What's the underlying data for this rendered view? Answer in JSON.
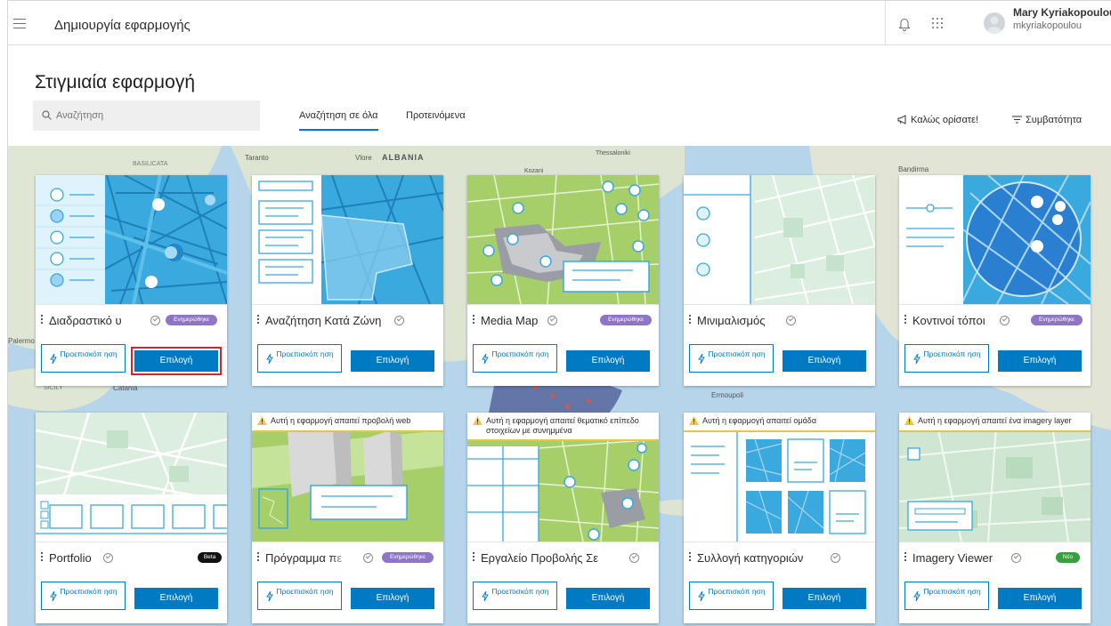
{
  "header": {
    "app_title": "Δημιουργία εφαρμογής",
    "user_name": "Mary Kyriakopoulou",
    "user_id": "mkyriakopoulou"
  },
  "page": {
    "title": "Στιγμιαία εφαρμογή",
    "search_placeholder": "Αναζήτηση",
    "tabs": [
      {
        "label": "Αναζήτηση σε όλα",
        "active": true
      },
      {
        "label": "Προτεινόμενα",
        "active": false
      }
    ],
    "welcome_label": "Καλώς ορίσατε!",
    "compat_label": "Συμβατότητα"
  },
  "map_labels": [
    {
      "text": "Taranto"
    },
    {
      "text": "Vlore"
    },
    {
      "text": "ALBANIA"
    },
    {
      "text": "BASILICATA"
    },
    {
      "text": "Thessaloniki"
    },
    {
      "text": "Kozani"
    },
    {
      "text": "Bandirma"
    },
    {
      "text": "Palermo"
    },
    {
      "text": "SICILY"
    },
    {
      "text": "Catania"
    },
    {
      "text": "Ermoupoli"
    }
  ],
  "cards": [
    {
      "title": "Διαδραστικό υ",
      "badge": "Ενημερώθηκε",
      "warning": "",
      "preview": "Προεπισκόπ ηση",
      "select": "Επιλογή"
    },
    {
      "title": "Αναζήτηση Κατά Ζώνη",
      "badge": "",
      "warning": "",
      "preview": "Προεπισκόπ ηση",
      "select": "Επιλογή"
    },
    {
      "title": "Media Map",
      "badge": "Ενημερώθηκε",
      "warning": "",
      "preview": "Προεπισκόπ ηση",
      "select": "Επιλογή"
    },
    {
      "title": "Μινιμαλισμός",
      "badge": "",
      "warning": "",
      "preview": "Προεπισκόπ ηση",
      "select": "Επιλογή"
    },
    {
      "title": "Κοντινοί τόποι",
      "badge": "Ενημερώθηκε",
      "warning": "",
      "preview": "Προεπισκόπ ηση",
      "select": "Επιλογή"
    },
    {
      "title": "Portfolio",
      "badge": "Beta",
      "warning": "",
      "preview": "Προεπισκόπ ηση",
      "select": "Επιλογή"
    },
    {
      "title": "Πρόγραμμα πε",
      "badge": "Ενημερώθηκε",
      "warning": "Αυτή η εφαρμογή απαιτεί προβολή web",
      "preview": "Προεπισκόπ ηση",
      "select": "Επιλογή"
    },
    {
      "title": "Εργαλείο Προβολής Σε",
      "badge": "",
      "warning": "Αυτή η εφαρμογή απαιτεί θεματικό επίπεδο στοιχείων με συνημμένα",
      "preview": "Προεπισκόπ ηση",
      "select": "Επιλογή"
    },
    {
      "title": "Συλλογή κατηγοριών",
      "badge": "",
      "warning": "Αυτή η εφαρμογή απαιτεί ομάδα",
      "preview": "Προεπισκόπ ηση",
      "select": "Επιλογή"
    },
    {
      "title": "Imagery Viewer",
      "badge": "Νέο",
      "warning": "Αυτή η εφαρμογή απαιτεί ένα imagery layer",
      "preview": "Προεπισκόπ ηση",
      "select": "Επιλογή"
    }
  ],
  "colors": {
    "accent": "#007ac2",
    "updated_badge": "#8f75c8",
    "new_badge": "#37a13e",
    "beta_badge": "#121212",
    "focus": "#d0262e"
  }
}
